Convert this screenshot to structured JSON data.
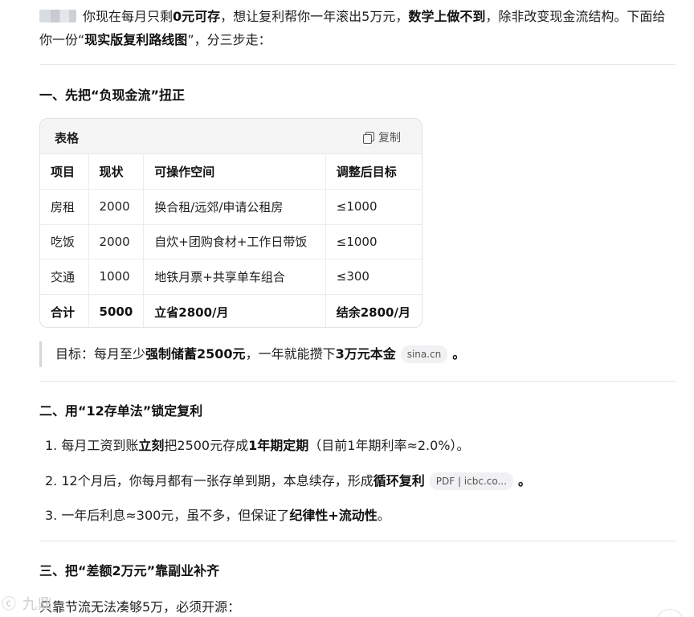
{
  "intro": {
    "p1": "你现在每月只剩",
    "b1": "0元可存",
    "p2": "，想让复利帮你一年滚出5万元，",
    "b2": "数学上做不到",
    "p3": "，除非改变现金流结构。下面给你一份“",
    "b3": "现实版复利路线图",
    "p4": "”，分三步走："
  },
  "section1": {
    "title": "一、先把“负现金流”扭正"
  },
  "table": {
    "title": "表格",
    "copy_label": "复制",
    "headers": [
      "项目",
      "现状",
      "可操作空间",
      "调整后目标"
    ],
    "rows": [
      [
        "房租",
        "2000",
        "换合租/远郊/申请公租房",
        "≤1000"
      ],
      [
        "吃饭",
        "2000",
        "自炊+团购食材+工作日带饭",
        "≤1000"
      ],
      [
        "交通",
        "1000",
        "地铁月票+共享单车组合",
        "≤300"
      ]
    ],
    "total": [
      "合计",
      "5000",
      "立省2800/月",
      "结余2800/月"
    ]
  },
  "quote": {
    "p1": "目标：每月至少",
    "b1": "强制储蓄2500元",
    "p2": "，一年就能攒下",
    "b2": "3万元本金",
    "chip": "sina.cn",
    "end": "。"
  },
  "section2": {
    "title": "二、用“12存单法”锁定复利",
    "items": [
      {
        "num": "1.",
        "p1": "每月工资到账",
        "b1": "立刻",
        "p2": "把2500元存成",
        "b2": "1年期定期",
        "p3": "（目前1年期利率≈2.0%）。"
      },
      {
        "num": "2.",
        "p1": "12个月后，你每月都有一张存单到期，本息续存，形成",
        "b1": "循环复利",
        "chip": "PDF | icbc.co...",
        "end": "。"
      },
      {
        "num": "3.",
        "p1": "一年后利息≈300元，虽不多，但保证了",
        "b1": "纪律性+流动性",
        "end": "。"
      }
    ]
  },
  "section3": {
    "title": "三、把“差额2万元”靠副业补齐"
  },
  "footer": {
    "text": "只靠节流无法凑够5万，必须开源："
  },
  "watermark": {
    "text": "ⓒ 九鼎"
  }
}
